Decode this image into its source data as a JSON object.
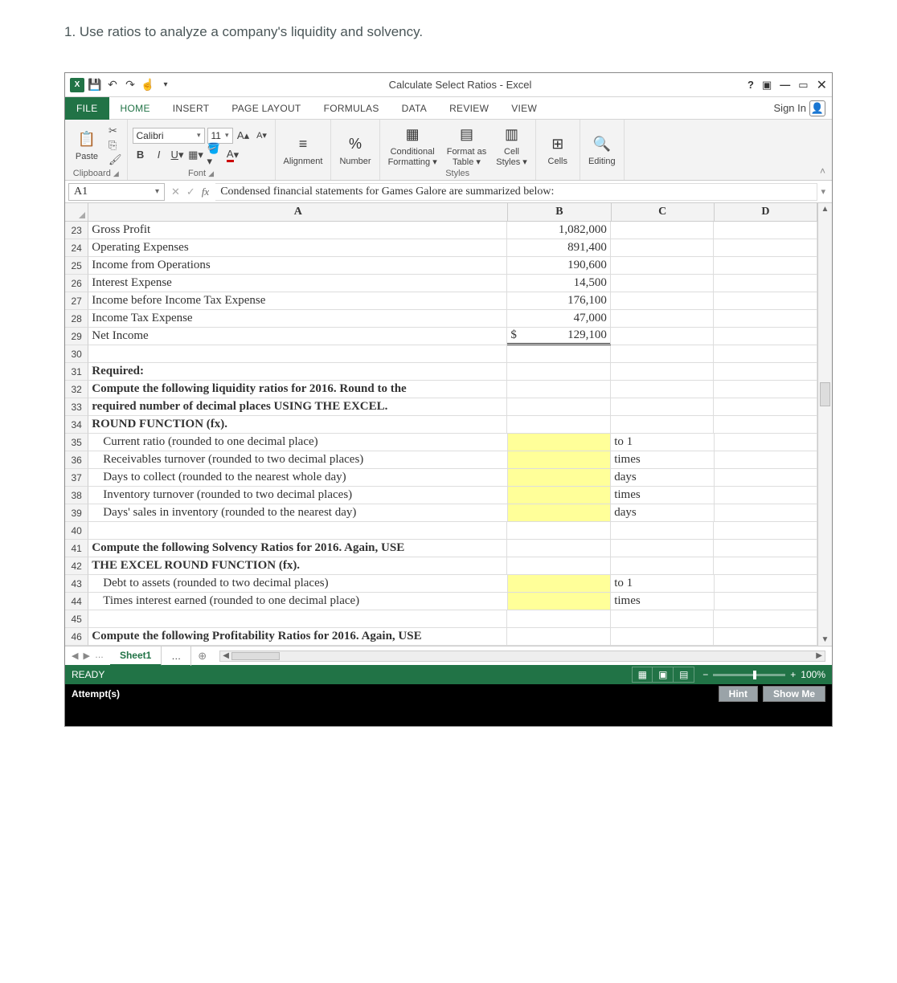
{
  "instruction": "1. Use ratios to analyze a company's liquidity and solvency.",
  "window_title": "Calculate Select Ratios - Excel",
  "tabs": {
    "file": "FILE",
    "home": "HOME",
    "insert": "INSERT",
    "page_layout": "PAGE LAYOUT",
    "formulas": "FORMULAS",
    "data": "DATA",
    "review": "REVIEW",
    "view": "VIEW"
  },
  "signin": "Sign In",
  "ribbon": {
    "clipboard": {
      "paste": "Paste",
      "label": "Clipboard"
    },
    "font": {
      "name": "Calibri",
      "size": "11",
      "label": "Font"
    },
    "alignment": "Alignment",
    "number": "Number",
    "styles": {
      "cond": "Conditional\nFormatting",
      "fmtas": "Format as\nTable",
      "cell": "Cell\nStyles",
      "label": "Styles"
    },
    "cells": "Cells",
    "editing": "Editing"
  },
  "namebox": "A1",
  "formula": "Condensed financial statements for Games Galore are summarized below:",
  "cols": {
    "A": "A",
    "B": "B",
    "C": "C",
    "D": "D"
  },
  "rows": [
    {
      "n": "23",
      "A": "Gross Profit",
      "B": "1,082,000",
      "num": true
    },
    {
      "n": "24",
      "A": "Operating Expenses",
      "B": "891,400",
      "num": true
    },
    {
      "n": "25",
      "A": "Income from Operations",
      "B": "190,600",
      "num": true
    },
    {
      "n": "26",
      "A": "Interest Expense",
      "B": "14,500",
      "num": true
    },
    {
      "n": "27",
      "A": "Income before Income Tax Expense",
      "B": "176,100",
      "num": true
    },
    {
      "n": "28",
      "A": "Income Tax Expense",
      "B": "47,000",
      "num": true
    },
    {
      "n": "29",
      "A": "Net Income",
      "B_dollar": "$",
      "B": "129,100",
      "num": true,
      "dbl": true
    },
    {
      "n": "30"
    },
    {
      "n": "31",
      "A": "Required:",
      "bold": true
    },
    {
      "n": "32",
      "A": "Compute the following liquidity ratios for 2016. Round to the",
      "bold": true
    },
    {
      "n": "33",
      "A": "required number of decimal places USING THE EXCEL.",
      "bold": true
    },
    {
      "n": "34",
      "A": "ROUND FUNCTION (fx).",
      "bold": true
    },
    {
      "n": "35",
      "A": "Current ratio (rounded to one decimal place)",
      "indent": true,
      "By": true,
      "C": "to 1"
    },
    {
      "n": "36",
      "A": "Receivables turnover (rounded to two decimal places)",
      "indent": true,
      "By": true,
      "C": "times"
    },
    {
      "n": "37",
      "A": "Days to collect (rounded to the nearest whole day)",
      "indent": true,
      "By": true,
      "C": "days"
    },
    {
      "n": "38",
      "A": "Inventory turnover (rounded to two decimal places)",
      "indent": true,
      "By": true,
      "C": "times"
    },
    {
      "n": "39",
      "A": "Days' sales in inventory (rounded to the nearest day)",
      "indent": true,
      "By": true,
      "C": "days"
    },
    {
      "n": "40"
    },
    {
      "n": "41",
      "A": "Compute the following Solvency Ratios for 2016. Again, USE",
      "bold": true
    },
    {
      "n": "42",
      "A": "THE EXCEL ROUND FUNCTION (fx).",
      "bold": true
    },
    {
      "n": "43",
      "A": "Debt to assets (rounded to two decimal places)",
      "indent": true,
      "By": true,
      "C": "to 1"
    },
    {
      "n": "44",
      "A": "Times interest earned (rounded to one decimal place)",
      "indent": true,
      "By": true,
      "C": "times"
    },
    {
      "n": "45"
    },
    {
      "n": "46",
      "A": "Compute the following Profitability Ratios for 2016. Again, USE",
      "bold": true
    }
  ],
  "sheet_tab": "Sheet1",
  "status": "READY",
  "zoom": "100%",
  "attempts": "Attempt(s)",
  "hint": "Hint",
  "showme": "Show Me"
}
